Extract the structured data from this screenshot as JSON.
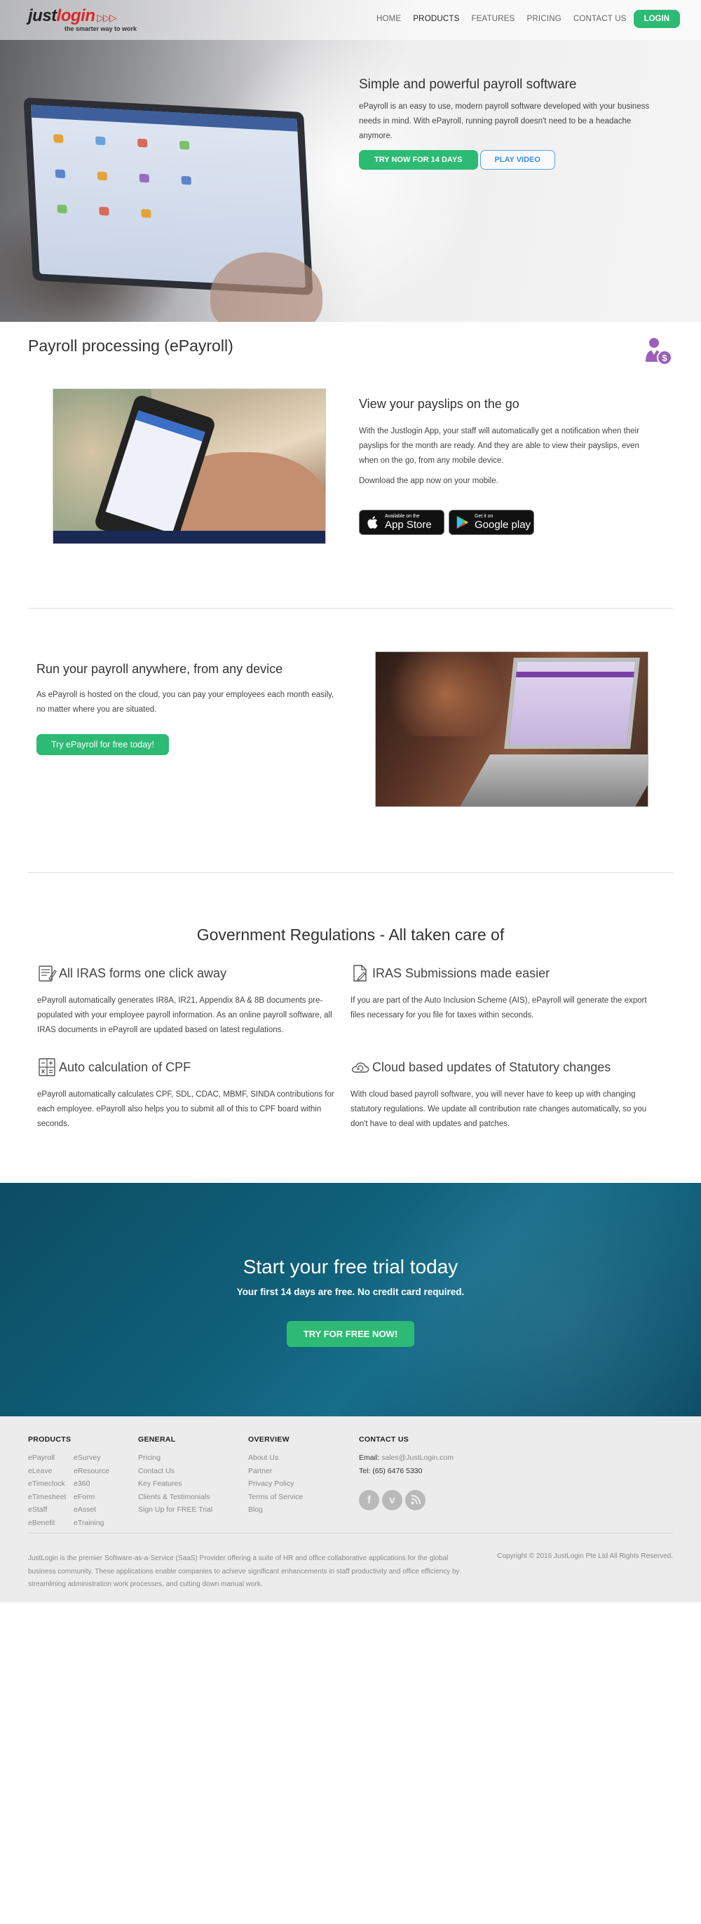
{
  "nav": {
    "logo_just": "just",
    "logo_login": "login",
    "logo_arrows": "▷▷▷",
    "logo_tagline": "the smarter way to work",
    "links": [
      "HOME",
      "PRODUCTS",
      "FEATURES",
      "PRICING",
      "CONTACT US"
    ],
    "active": "PRODUCTS",
    "login_label": "LOGIN"
  },
  "hero": {
    "title": "Simple and powerful payroll software",
    "text": "ePayroll is an easy to use, modern payroll software developed with your business needs in mind. With ePayroll, running payroll doesn't need to be a headache anymore.",
    "trial_label": "TRY NOW FOR 14 DAYS",
    "video_label": "PLAY VIDEO"
  },
  "payroll": {
    "title": "Payroll processing (ePayroll)",
    "mobile_title": "View your payslips on the go",
    "mobile_text": "With the Justlogin App, your staff will automatically get a notification when their payslips for the month are ready. And they are able to view their payslips, even when on the go, from any mobile device.",
    "mobile_download": "Download the app now on your mobile.",
    "appstore_small": "Available on the",
    "appstore_big": "App Store",
    "googleplay_small": "Get it on",
    "googleplay_big": "Google play"
  },
  "anywhere": {
    "title": "Run your payroll anywhere, from any device",
    "text": "As ePayroll is hosted on the cloud, you can pay your employees each month easily, no matter where you are situated.",
    "button": "Try ePayroll for free today!"
  },
  "gov": {
    "title": "Government Regulations - All taken care of",
    "features": [
      {
        "icon": "form-icon",
        "title": "All IRAS forms one click away",
        "text": "ePayroll automatically generates IR8A, IR21, Appendix 8A & 8B documents pre-populated with your employee payroll information. As an online payroll software, all IRAS documents in ePayroll are updated based on latest regulations."
      },
      {
        "icon": "document-edit-icon",
        "title": "IRAS Submissions made easier",
        "text": "If you are part of the Auto Inclusion Scheme (AIS), ePayroll will generate the export files necessary for you file for taxes within seconds."
      },
      {
        "icon": "calculator-icon",
        "title": "Auto calculation of CPF",
        "text": "ePayroll automatically calculates CPF, SDL, CDAC, MBMF, SINDA contributions for each employee. ePayroll also helps you to submit all of this to CPF board within seconds."
      },
      {
        "icon": "cloud-refresh-icon",
        "title": "Cloud based updates of Statutory changes",
        "text": "With cloud based payroll software, you will never have to keep up with changing statutory regulations. We update all contribution rate changes automatically, so you don't have to deal with updates and patches."
      }
    ]
  },
  "cta": {
    "title": "Start your free trial today",
    "subtitle": "Your first 14 days are free. No credit card required.",
    "button": "TRY FOR FREE NOW!"
  },
  "footer": {
    "products_head": "PRODUCTS",
    "products_col1": [
      "ePayroll",
      "eLeave",
      "eTimeclock",
      "eTimesheet",
      "eStaff",
      "eBenefit"
    ],
    "products_col2": [
      "eSurvey",
      "eResource",
      "e360",
      "eForm",
      "eAsset",
      "eTraining"
    ],
    "general_head": "GENERAL",
    "general": [
      "Pricing",
      "Contact Us",
      "Key Features",
      "Clients & Testimonials",
      "Sign Up for FREE Trial"
    ],
    "overview_head": "OVERVIEW",
    "overview": [
      "About Us",
      "Partner",
      "Privacy Policy",
      "Terms of Service",
      "Blog"
    ],
    "contact_head": "CONTACT US",
    "email_label": "Email:",
    "email": "sales@JustLogin.com",
    "tel": "Tel: (65) 6476 5330",
    "about": "JustLogin is the premier Software-as-a-Service (SaaS) Provider offering a suite of HR and office collaborative applications for the global business community. These applications enable companies to achieve significant enhancements in staff productivity and office efficiency by streamlining administration work processes, and cutting down manual work.",
    "copyright": "Copyright © 2016 JustLogin Pte Ltd All Rights Reserved."
  },
  "colors": {
    "brand_green": "#2dba75",
    "brand_red": "#d9262a",
    "cta_teal": "#0f5f78",
    "icon_purple": "#9b5fb8"
  }
}
